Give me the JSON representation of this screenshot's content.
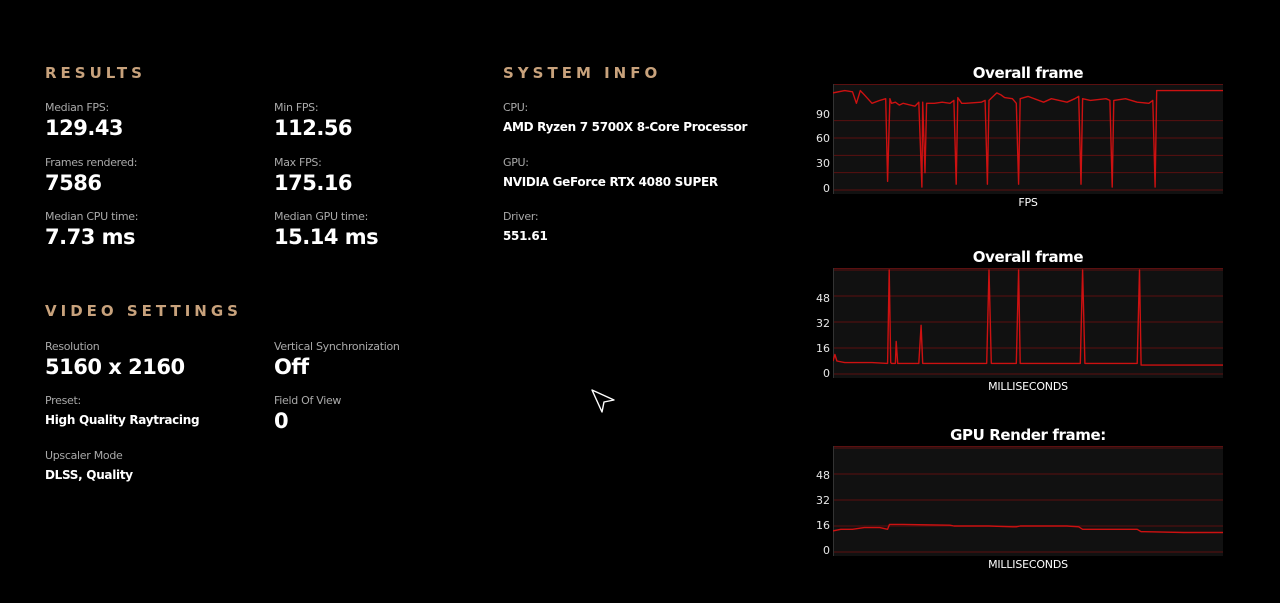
{
  "results": {
    "title": "RESULTS",
    "median_fps": {
      "label": "Median FPS:",
      "value": "129.43"
    },
    "min_fps": {
      "label": "Min FPS:",
      "value": "112.56"
    },
    "frames_rendered": {
      "label": "Frames rendered:",
      "value": "7586"
    },
    "max_fps": {
      "label": "Max FPS:",
      "value": "175.16"
    },
    "median_cpu": {
      "label": "Median CPU time:",
      "value": "7.73 ms"
    },
    "median_gpu": {
      "label": "Median GPU time:",
      "value": "15.14 ms"
    }
  },
  "system": {
    "title": "SYSTEM INFO",
    "cpu": {
      "label": "CPU:",
      "value": "AMD Ryzen 7 5700X 8-Core Processor"
    },
    "gpu": {
      "label": "GPU:",
      "value": "NVIDIA GeForce RTX 4080 SUPER"
    },
    "driver": {
      "label": "Driver:",
      "value": "551.61"
    }
  },
  "video": {
    "title": "VIDEO SETTINGS",
    "resolution": {
      "label": "Resolution",
      "value": "5160 x 2160"
    },
    "vsync": {
      "label": "Vertical Synchronization",
      "value": "Off"
    },
    "preset": {
      "label": "Preset:",
      "value": "High Quality Raytracing"
    },
    "fov": {
      "label": "Field Of View",
      "value": "0"
    },
    "upscaler": {
      "label": "Upscaler Mode",
      "value": "DLSS, Quality"
    }
  },
  "colors": {
    "accent": "#c8a27c",
    "series": "#cc1111",
    "grid": "#5a1010",
    "plot_bg": "#111111"
  },
  "chart_data": [
    {
      "type": "line",
      "title": "Overall frame",
      "xlabel": "FPS",
      "ylabel": "",
      "y_ticks": [
        "0",
        "30",
        "60",
        "90"
      ],
      "ylim": [
        0,
        180
      ],
      "grid": true,
      "series": [
        {
          "x": [
            0,
            3,
            5,
            6,
            7,
            8,
            10,
            12,
            13.5,
            14,
            14.6,
            15,
            16,
            17,
            18,
            21,
            22,
            22.8,
            23,
            23.6,
            24,
            26,
            28,
            30,
            31,
            31.6,
            32,
            33,
            34,
            38,
            39,
            39.6,
            40,
            42,
            43,
            44,
            46,
            47,
            47.6,
            48,
            50,
            54,
            56,
            60,
            62,
            63,
            63.6,
            64,
            66,
            70,
            71,
            71.6,
            72,
            75,
            78,
            81,
            82,
            82.6,
            83,
            84,
            86,
            90,
            95,
            100
          ],
          "y": [
            168,
            172,
            170,
            150,
            172,
            165,
            150,
            155,
            158,
            15,
            158,
            150,
            152,
            147,
            150,
            145,
            152,
            5,
            152,
            30,
            150,
            150,
            152,
            150,
            155,
            10,
            160,
            150,
            150,
            152,
            155,
            10,
            155,
            168,
            165,
            160,
            158,
            150,
            10,
            158,
            162,
            152,
            158,
            152,
            158,
            162,
            10,
            158,
            155,
            158,
            155,
            5,
            155,
            158,
            152,
            150,
            155,
            5,
            172,
            172,
            172,
            172,
            172,
            172
          ]
        }
      ]
    },
    {
      "type": "line",
      "title": "Overall frame",
      "xlabel": "MILLISECONDS",
      "ylabel": "",
      "y_ticks": [
        "0",
        "16",
        "32",
        "48"
      ],
      "ylim": [
        0,
        64
      ],
      "grid": true,
      "series": [
        {
          "x": [
            0,
            0.5,
            1,
            3,
            10,
            14,
            14.4,
            14.8,
            15,
            16,
            16.2,
            16.6,
            17,
            20,
            22,
            22.6,
            23,
            30,
            31.6,
            32,
            39.4,
            40,
            40.6,
            41,
            47,
            47.6,
            48,
            60,
            63.4,
            64,
            64.6,
            65,
            76,
            78,
            78.6,
            79,
            100
          ],
          "y": [
            8,
            12,
            8,
            7,
            7,
            6.5,
            64,
            7,
            6.5,
            6.5,
            20,
            6.5,
            6.5,
            6.5,
            6.5,
            30,
            6.5,
            6.5,
            6.5,
            6.5,
            6.5,
            64,
            6.5,
            6.5,
            6.5,
            64,
            6.5,
            6.5,
            6.5,
            64,
            6.5,
            6.5,
            6.5,
            6.5,
            64,
            5.5,
            5.5
          ]
        }
      ]
    },
    {
      "type": "line",
      "title": "GPU Render frame:",
      "xlabel": "MILLISECONDS",
      "ylabel": "",
      "y_ticks": [
        "0",
        "16",
        "32",
        "48"
      ],
      "ylim": [
        0,
        64
      ],
      "grid": true,
      "series": [
        {
          "x": [
            0,
            2,
            5,
            8,
            12,
            14,
            14.5,
            18,
            30,
            31,
            32,
            40,
            46,
            47,
            48,
            60,
            63,
            64,
            70,
            78,
            79,
            80,
            90,
            100
          ],
          "y": [
            13,
            14,
            14,
            15,
            15,
            14,
            17,
            17,
            16.5,
            16,
            16,
            16,
            15.5,
            15.5,
            16,
            16,
            15.5,
            14,
            14,
            14,
            12.5,
            12.5,
            12,
            12
          ]
        }
      ]
    }
  ]
}
